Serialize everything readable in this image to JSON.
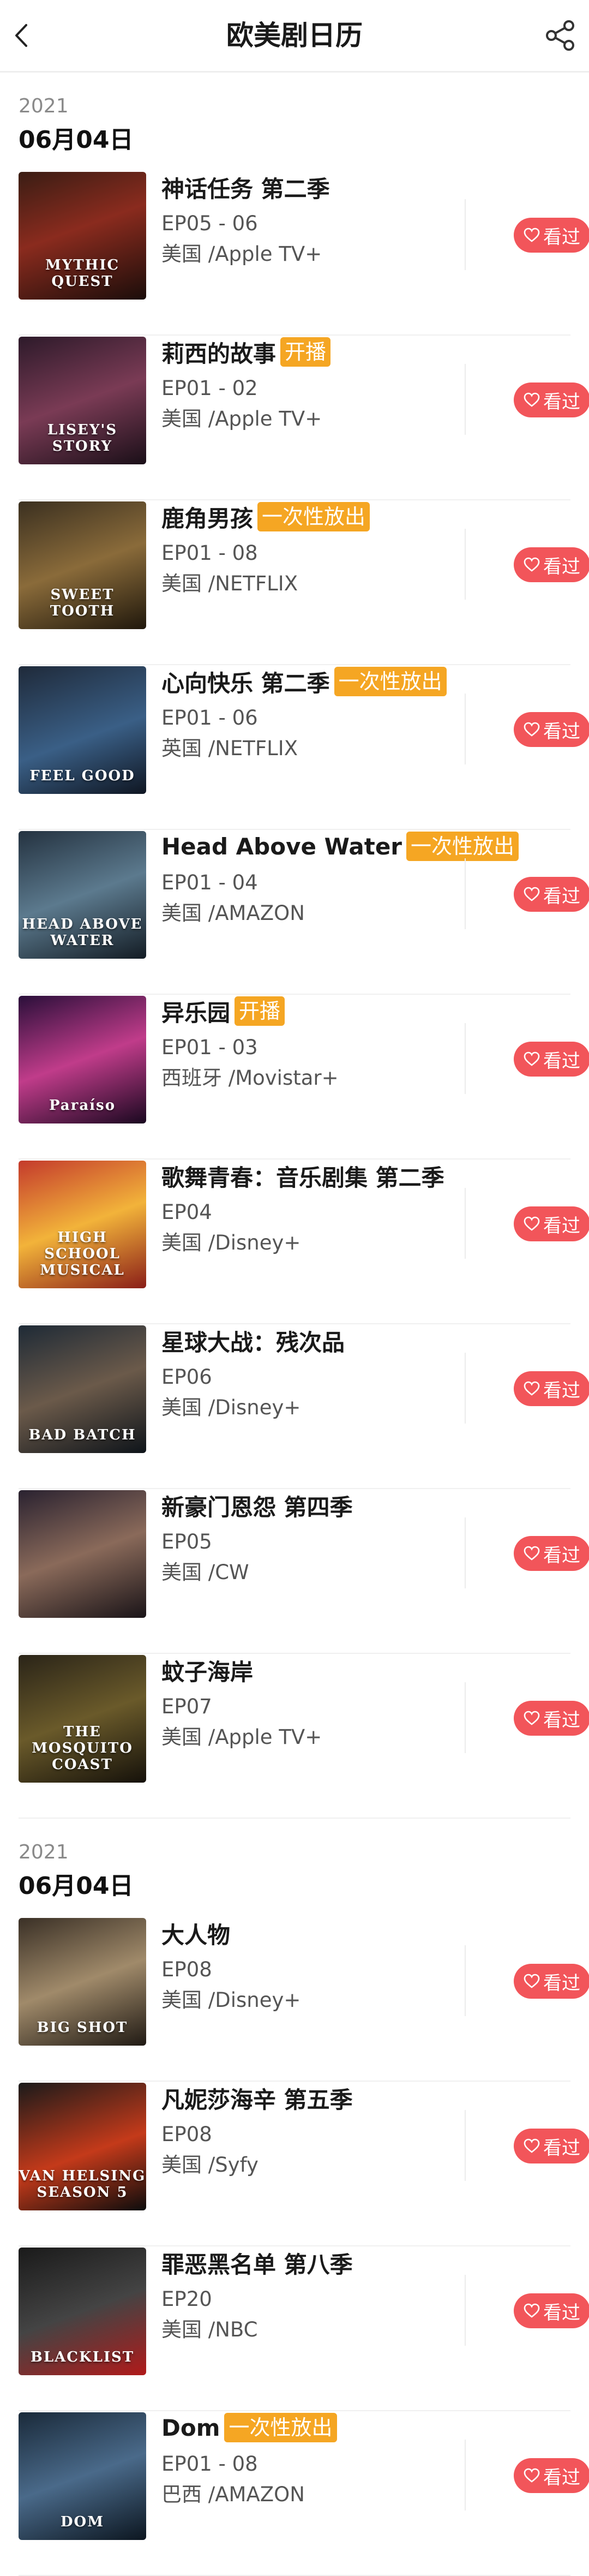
{
  "header": {
    "title": "欧美剧日历"
  },
  "colors": {
    "watch_button": "#f2555a",
    "badge": "#f5a623"
  },
  "sections": [
    {
      "year": "2021",
      "date": "06月04日",
      "items": [
        {
          "name": "神话任务 第二季",
          "badge": "",
          "ep": "EP05 - 06",
          "country": "美国 /Apple TV+",
          "poster_text": "MYTHIC QUEST",
          "watch": "看过"
        },
        {
          "name": "莉西的故事",
          "badge": "开播",
          "ep": "EP01 - 02",
          "country": "美国 /Apple TV+",
          "poster_text": "LISEY'S STORY",
          "watch": "看过"
        },
        {
          "name": "鹿角男孩",
          "badge": "一次性放出",
          "ep": "EP01 - 08",
          "country": "美国 /NETFLIX",
          "poster_text": "SWEET TOOTH",
          "watch": "看过"
        },
        {
          "name": "心向快乐 第二季",
          "badge": "一次性放出",
          "ep": "EP01 - 06",
          "country": "英国 /NETFLIX",
          "poster_text": "FEEL GOOD",
          "watch": "看过"
        },
        {
          "name": "Head Above Water",
          "badge": "一次性放出",
          "ep": "EP01 - 04",
          "country": "美国 /AMAZON",
          "poster_text": "HEAD ABOVE WATER",
          "watch": "看过"
        },
        {
          "name": "异乐园",
          "badge": "开播",
          "ep": "EP01 - 03",
          "country": "西班牙 /Movistar+",
          "poster_text": "Paraíso",
          "watch": "看过"
        },
        {
          "name": "歌舞青春：音乐剧集 第二季",
          "badge": "",
          "ep": "EP04",
          "country": "美国 /Disney+",
          "poster_text": "HIGH SCHOOL MUSICAL",
          "watch": "看过"
        },
        {
          "name": "星球大战：残次品",
          "badge": "",
          "ep": "EP06",
          "country": "美国 /Disney+",
          "poster_text": "BAD BATCH",
          "watch": "看过"
        },
        {
          "name": "新豪门恩怨 第四季",
          "badge": "",
          "ep": "EP05",
          "country": "美国 /CW",
          "poster_text": "",
          "watch": "看过"
        },
        {
          "name": "蚊子海岸",
          "badge": "",
          "ep": "EP07",
          "country": "美国 /Apple TV+",
          "poster_text": "THE MOSQUITO COAST",
          "watch": "看过"
        }
      ]
    },
    {
      "year": "2021",
      "date": "06月04日",
      "items": [
        {
          "name": "大人物",
          "badge": "",
          "ep": "EP08",
          "country": "美国 /Disney+",
          "poster_text": "BIG SHOT",
          "watch": "看过"
        },
        {
          "name": "凡妮莎海辛 第五季",
          "badge": "",
          "ep": "EP08",
          "country": "美国 /Syfy",
          "poster_text": "VAN HELSING SEASON 5",
          "watch": "看过"
        },
        {
          "name": "罪恶黑名单 第八季",
          "badge": "",
          "ep": "EP20",
          "country": "美国 /NBC",
          "poster_text": "BLACKLIST",
          "watch": "看过"
        },
        {
          "name": "Dom",
          "badge": "一次性放出",
          "ep": "EP01 - 08",
          "country": "巴西 /AMAZON",
          "poster_text": "DOM",
          "watch": "看过"
        }
      ]
    }
  ]
}
